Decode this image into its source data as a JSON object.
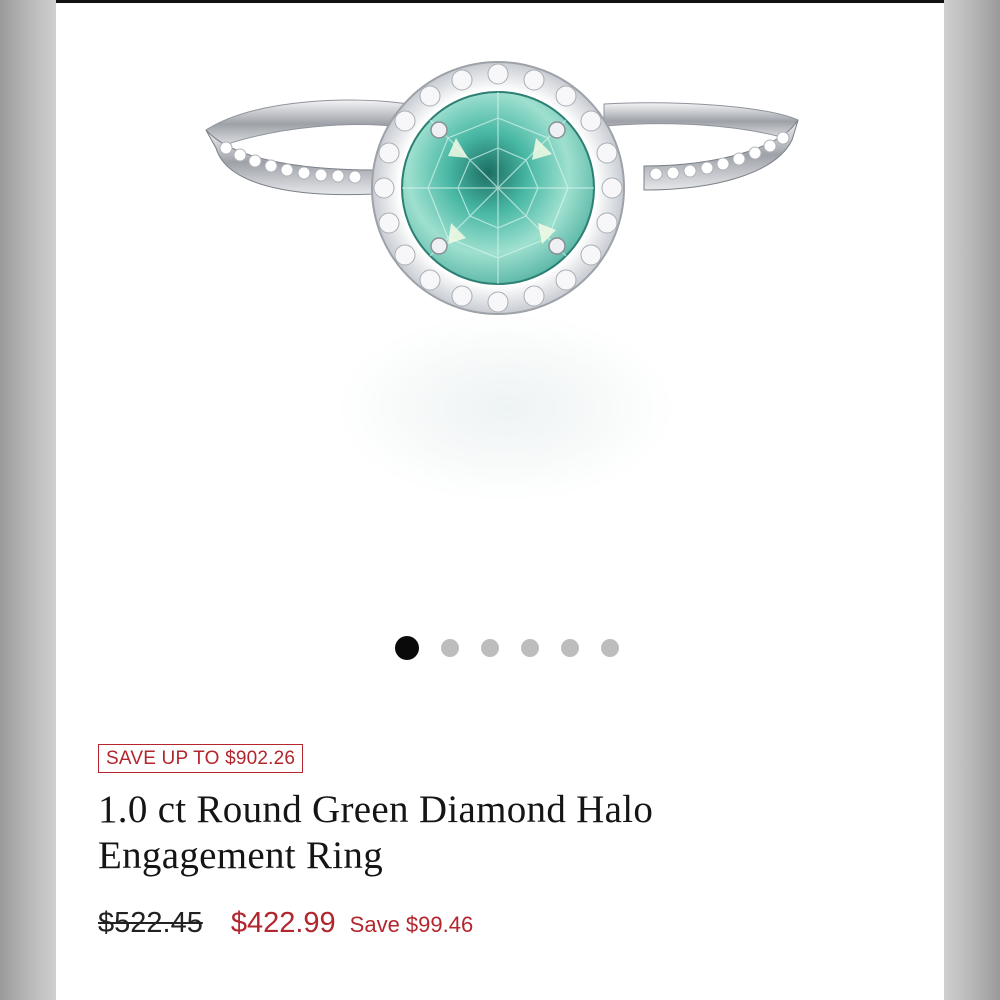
{
  "product": {
    "image_alt": "ring-photo",
    "gallery_count": 6,
    "gallery_active_index": 0,
    "badge": "SAVE UP TO $902.26",
    "title_line1": "1.0 ct Round Green Diamond Halo",
    "title_line2": "Engagement Ring",
    "price_original": "$522.45",
    "price_sale": "$422.99",
    "price_savings": "Save $99.46"
  },
  "colors": {
    "accent_red": "#b3262d",
    "dot_active": "#0a0a0a",
    "dot_inactive": "#bdbdbd",
    "gem_green": "#3fae9a"
  }
}
